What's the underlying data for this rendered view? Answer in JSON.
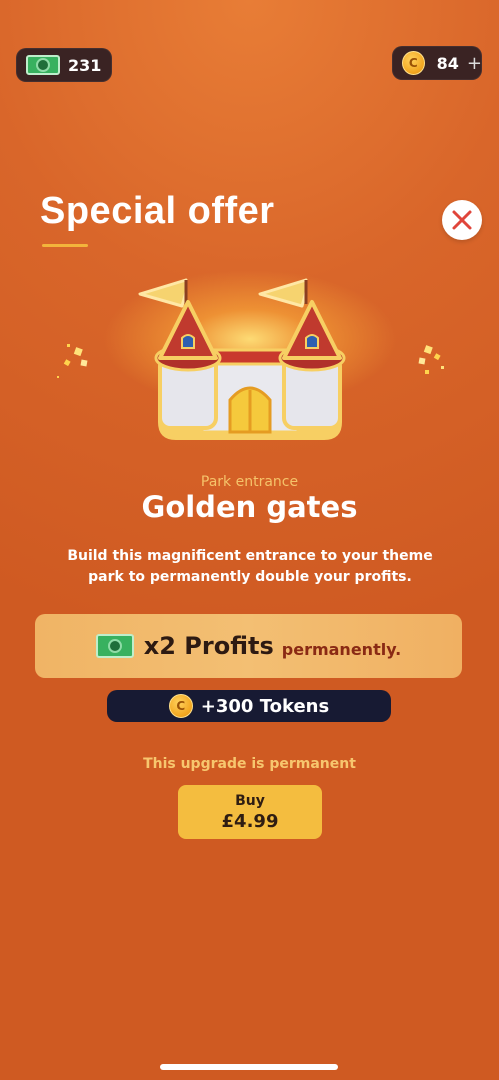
{
  "header": {
    "cash_count": "231",
    "coin_count": "84",
    "coin_plus": "+"
  },
  "offer": {
    "title": "Special offer",
    "subtitle": "Park entrance",
    "name": "Golden gates",
    "description": "Build this magnificent entrance to your theme park to permanently double your profits.",
    "profit_main": "x2 Profits",
    "profit_suffix": "permanently.",
    "tokens": "+300 Tokens",
    "permanent_note": "This upgrade is permanent",
    "buy_label": "Buy",
    "price": "£4.99"
  },
  "icons": {
    "cash": "cash-icon",
    "coin": "coin-icon",
    "close": "close-icon"
  },
  "colors": {
    "accent_gold": "#f4bd3f",
    "close_red": "#e0453b",
    "dark_chip": "#3a2323",
    "tokens_bg": "#171a33"
  }
}
